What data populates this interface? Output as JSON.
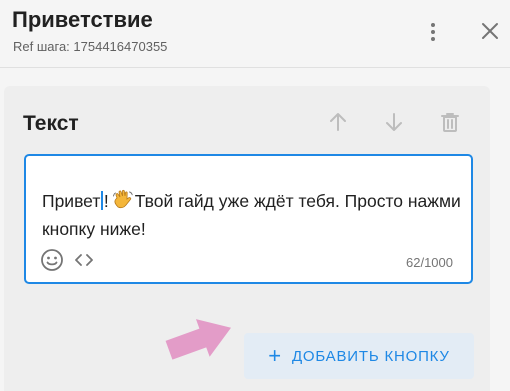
{
  "header": {
    "title": "Приветствие",
    "ref_label": "Ref шага: 1754416470355"
  },
  "card": {
    "title": "Текст",
    "editor": {
      "text_before_caret": "Привет",
      "text_after_caret": "!",
      "emoji": "waving-hand",
      "text_after_emoji": "Твой гайд уже ждёт тебя. Просто нажми кнопку ниже!",
      "counter": "62/1000"
    },
    "add_button_label": "ДОБАВИТЬ КНОПКУ"
  },
  "colors": {
    "accent": "#1e88e5",
    "button_bg": "#e3ecf5",
    "arrow": "#e39cc8",
    "icon_muted": "#bdbdbd"
  }
}
